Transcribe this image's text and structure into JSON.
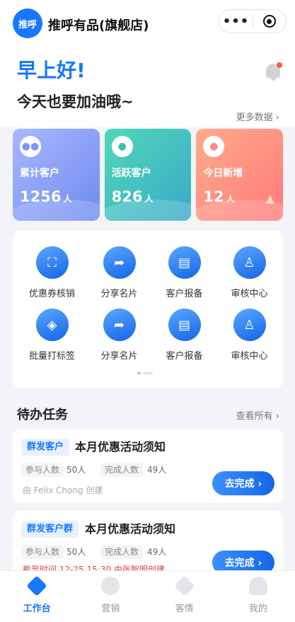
{
  "header": {
    "logo_text": "推呼",
    "shop_name": "推呼有品(旗舰店)",
    "menu_dots": "•••"
  },
  "hero": {
    "greeting": "早上好!",
    "motto": "今天也要加油哦~",
    "more_data": "更多数据 ›"
  },
  "stats": [
    {
      "label": "累计客户",
      "value": "1256",
      "unit": "人"
    },
    {
      "label": "活跃客户",
      "value": "826",
      "unit": "人"
    },
    {
      "label": "今日新增",
      "value": "12",
      "unit": "人"
    }
  ],
  "grid": [
    {
      "label": "优惠券核销",
      "icon": "scan-icon"
    },
    {
      "label": "分享名片",
      "icon": "share-card-icon"
    },
    {
      "label": "客户报备",
      "icon": "printer-icon"
    },
    {
      "label": "审核中心",
      "icon": "stamp-icon"
    },
    {
      "label": "批量打标签",
      "icon": "tag-icon"
    },
    {
      "label": "分享名片",
      "icon": "share-card-icon"
    },
    {
      "label": "客户报备",
      "icon": "printer-icon"
    },
    {
      "label": "审核中心",
      "icon": "stamp-icon"
    }
  ],
  "tasks_section": {
    "title": "待办任务",
    "see_all": "查看所有 ›"
  },
  "tasks": [
    {
      "tag": "群发客户",
      "title": "本月优惠活动须知",
      "participants_label": "参与人数",
      "participants": "50人",
      "completed_label": "完成人数",
      "completed": "49人",
      "creator": "由 Felix Chong 创建",
      "action": "去完成 ›"
    },
    {
      "tag": "群发客户群",
      "title": "本月优惠活动须知",
      "participants_label": "参与人数",
      "participants": "50人",
      "completed_label": "完成人数",
      "completed": "49人",
      "deadline": "截至时间 12-25 15:30 由张智明创建",
      "action": "去完成 ›"
    }
  ],
  "tabbar": [
    {
      "label": "工作台",
      "active": true
    },
    {
      "label": "营销",
      "active": false
    },
    {
      "label": "客情",
      "active": false
    },
    {
      "label": "我的",
      "active": false
    }
  ],
  "colors": {
    "accent": "#1677ff",
    "alert": "#ff5a3c"
  }
}
